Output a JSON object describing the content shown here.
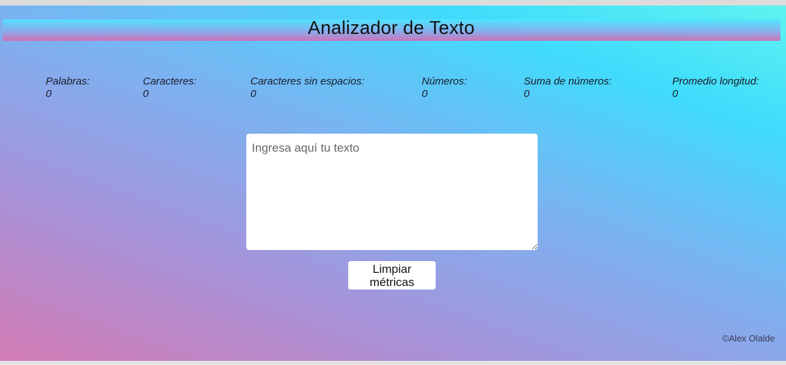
{
  "header": {
    "title": "Analizador de Texto"
  },
  "metrics": [
    {
      "label": "Palabras:",
      "value": "0"
    },
    {
      "label": "Caracteres:",
      "value": "0"
    },
    {
      "label": "Caracteres sin espacios:",
      "value": "0"
    },
    {
      "label": "Números:",
      "value": "0"
    },
    {
      "label": "Suma de números:",
      "value": "0"
    },
    {
      "label": "Promedio longitud:",
      "value": "0"
    }
  ],
  "input": {
    "placeholder": "Ingresa aquí tu texto",
    "value": ""
  },
  "actions": {
    "clear_label": "Limpiar métricas"
  },
  "footer": {
    "credit": "©Alex Olalde"
  },
  "colors": {
    "gradient_pink": "#d27bb3",
    "gradient_purple": "#a693da",
    "gradient_blue": "#7ab3f2",
    "gradient_cyan": "#3fdcfc"
  }
}
